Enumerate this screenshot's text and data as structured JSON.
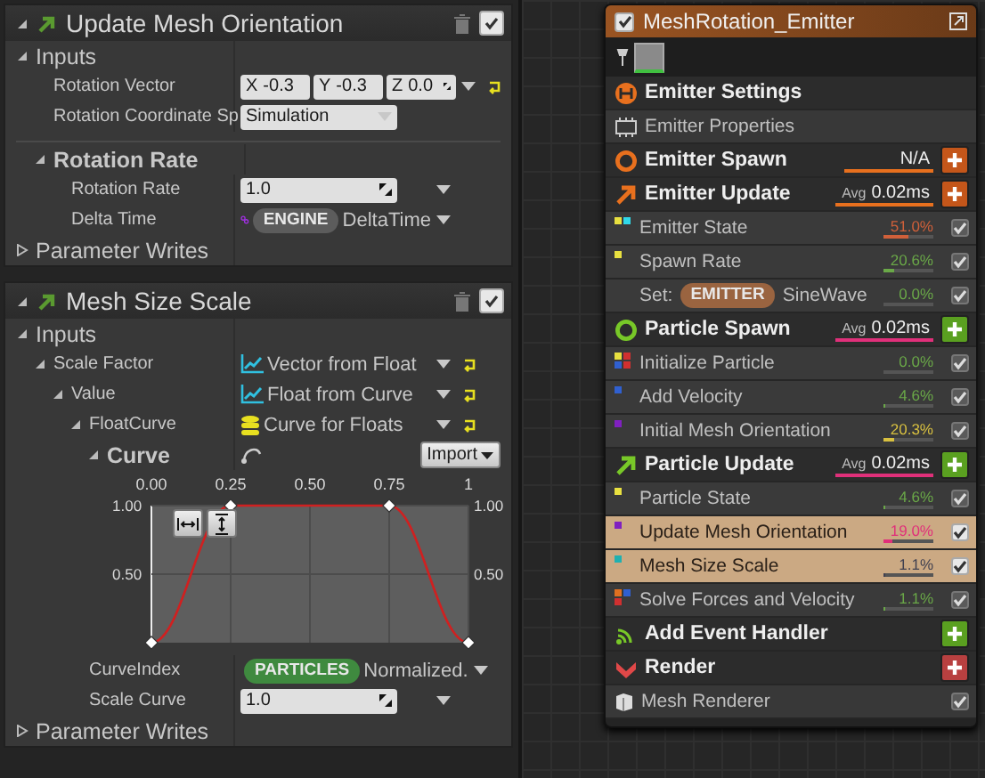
{
  "left_panel": {
    "modules": [
      {
        "title": "Update Mesh Orientation",
        "enabled": true,
        "rows": [
          {
            "kind": "category",
            "label": "Inputs",
            "expanded": true,
            "children": [
              {
                "kind": "vector",
                "label": "Rotation Vector",
                "components": [
                  {
                    "axis": "X",
                    "value": "-0.3"
                  },
                  {
                    "axis": "Y",
                    "value": "-0.3"
                  },
                  {
                    "axis": "Z",
                    "value": "0.0"
                  }
                ],
                "menu": true,
                "reset": true
              },
              {
                "kind": "dropdown",
                "label": "Rotation Coordinate Sp",
                "value": "Simulation",
                "menu": false,
                "reset": false
              },
              {
                "kind": "category",
                "label": "Rotation Rate",
                "expanded": true,
                "children": [
                  {
                    "kind": "number",
                    "label": "Rotation Rate",
                    "value": "1.0",
                    "menu": true,
                    "reset": false
                  },
                  {
                    "kind": "link",
                    "label": "Delta Time",
                    "namespace": {
                      "label": "ENGINE",
                      "color": "#5c5c5c"
                    },
                    "value": "DeltaTime",
                    "menu": true,
                    "reset": false
                  }
                ]
              }
            ]
          },
          {
            "kind": "category",
            "label": "Parameter Writes",
            "expanded": false
          }
        ]
      },
      {
        "title": "Mesh Size Scale",
        "enabled": true,
        "rows": [
          {
            "kind": "category",
            "label": "Inputs",
            "expanded": true,
            "children": [
              {
                "kind": "function",
                "label": "Scale Factor",
                "value": "Vector from Float",
                "expanded": true,
                "menu": true,
                "reset": true,
                "children": [
                  {
                    "kind": "function",
                    "label": "Value",
                    "value": "Float from Curve",
                    "expanded": true,
                    "menu": true,
                    "reset": true,
                    "children": [
                      {
                        "kind": "asset",
                        "label": "FloatCurve",
                        "value": "Curve for Floats",
                        "expanded": true,
                        "menu": true,
                        "reset": true,
                        "children": [
                          {
                            "kind": "curve",
                            "label": "Curve",
                            "expanded": true,
                            "import_button": "Import",
                            "chart_data": {
                              "type": "line",
                              "x": [
                                0,
                                0.25,
                                0.75,
                                1
                              ],
                              "grid": true,
                              "series": [
                                {
                                  "color": "#d02020",
                                  "marker": "diamond",
                                  "values": [
                                    0,
                                    1,
                                    1,
                                    0
                                  ]
                                }
                              ],
                              "xlim": [
                                0,
                                1
                              ],
                              "ylim": [
                                0,
                                1
                              ],
                              "xticks": [
                                {
                                  "value": 0,
                                  "label": "0.00"
                                },
                                {
                                  "value": 0.25,
                                  "label": "0.25"
                                },
                                {
                                  "value": 0.5,
                                  "label": "0.50"
                                },
                                {
                                  "value": 0.75,
                                  "label": "0.75"
                                },
                                {
                                  "value": 1,
                                  "label": "1"
                                }
                              ],
                              "yticks": [
                                {
                                  "value": 0.5,
                                  "label": "0.50"
                                },
                                {
                                  "value": 1,
                                  "label": "1.00"
                                }
                              ]
                            }
                          }
                        ]
                      },
                      {
                        "kind": "link",
                        "label": "CurveIndex",
                        "namespace": {
                          "label": "PARTICLES",
                          "color": "#3f8a3f"
                        },
                        "value": "Normalized.",
                        "menu": true,
                        "reset": false
                      },
                      {
                        "kind": "number",
                        "label": "Scale Curve",
                        "value": "1.0",
                        "menu": true,
                        "reset": false
                      }
                    ]
                  }
                ]
              }
            ]
          },
          {
            "kind": "category",
            "label": "Parameter Writes",
            "expanded": false
          }
        ]
      }
    ]
  },
  "emitter_node": {
    "title": "MeshRotation_Emitter",
    "enabled": true,
    "items": [
      {
        "kind": "section",
        "label": "Emitter Settings",
        "color": "#e8701e"
      },
      {
        "kind": "property",
        "label": "Emitter Properties"
      },
      {
        "kind": "section",
        "label": "Emitter Spawn",
        "color": "#e8701e",
        "stat": {
          "value": "N/A",
          "color": "#e8701e"
        },
        "add_button": {
          "color": "#c4561a"
        }
      },
      {
        "kind": "section",
        "label": "Emitter Update",
        "color": "#e8701e",
        "stat": {
          "prefix": "Avg",
          "value": "0.02ms",
          "color": "#e8701e"
        },
        "add_button": {
          "color": "#c4561a"
        }
      },
      {
        "kind": "module",
        "label": "Emitter State",
        "percent": "51.0%",
        "level": 0.51,
        "color": "#d0603a",
        "checked": true,
        "selected": false,
        "dots": [
          {
            "color": "#e8e040"
          },
          {
            "color": "#30d8e8"
          }
        ]
      },
      {
        "kind": "module",
        "label": "Spawn Rate",
        "percent": "20.6%",
        "level": 0.206,
        "color": "#6aa848",
        "checked": true,
        "selected": false,
        "dots": [
          {
            "color": "#e8e040"
          }
        ]
      },
      {
        "kind": "module",
        "prefix": "Set:",
        "namespace": {
          "label": "EMITTER",
          "color": "#9a6440"
        },
        "label": "SineWave",
        "percent": "0.0%",
        "level": 0,
        "color": "#6aa848",
        "checked": true,
        "selected": false
      },
      {
        "kind": "section",
        "label": "Particle Spawn",
        "color": "#78c828",
        "stat": {
          "prefix": "Avg",
          "value": "0.02ms",
          "color": "#e0307a"
        },
        "add_button": {
          "color": "#5aa020"
        }
      },
      {
        "kind": "module",
        "label": "Initialize Particle",
        "percent": "0.0%",
        "level": 0,
        "color": "#6aa848",
        "checked": true,
        "selected": false,
        "dots": [
          {
            "color": "#e8e040"
          },
          {
            "color": "#d03030"
          },
          {
            "color": "#3060d0"
          },
          {
            "color": "#d03030"
          }
        ]
      },
      {
        "kind": "module",
        "label": "Add Velocity",
        "percent": "4.6%",
        "level": 0.046,
        "color": "#6aa848",
        "checked": true,
        "selected": false,
        "dots": [
          {
            "color": "#3060d0"
          }
        ]
      },
      {
        "kind": "module",
        "label": "Initial Mesh Orientation",
        "percent": "20.3%",
        "level": 0.203,
        "color": "#d8c040",
        "checked": true,
        "selected": false,
        "dots": [
          {
            "color": "#8020c0"
          }
        ]
      },
      {
        "kind": "section",
        "label": "Particle Update",
        "color": "#78c828",
        "stat": {
          "prefix": "Avg",
          "value": "0.02ms",
          "color": "#e0307a"
        },
        "add_button": {
          "color": "#5aa020"
        }
      },
      {
        "kind": "module",
        "label": "Particle State",
        "percent": "4.6%",
        "level": 0.046,
        "color": "#6aa848",
        "checked": true,
        "selected": false,
        "dots": [
          {
            "color": "#e8e040"
          }
        ]
      },
      {
        "kind": "module",
        "label": "Update Mesh Orientation",
        "percent": "19.0%",
        "level": 0.19,
        "color": "#e0307a",
        "checked": true,
        "selected": true,
        "dots": [
          {
            "color": "#8020c0"
          }
        ]
      },
      {
        "kind": "module",
        "label": "Mesh Size Scale",
        "percent": "1.1%",
        "level": 0.011,
        "color": "#404050",
        "checked": true,
        "selected": true,
        "dots": [
          {
            "color": "#20b0b0"
          }
        ]
      },
      {
        "kind": "module",
        "label": "Solve Forces and Velocity",
        "percent": "1.1%",
        "level": 0.011,
        "color": "#6aa848",
        "checked": true,
        "selected": false,
        "dots": [
          {
            "color": "#e07020"
          },
          {
            "color": "#3060d0"
          },
          {
            "color": "#d03030"
          }
        ]
      },
      {
        "kind": "section",
        "label": "Add Event Handler",
        "color": "#78c828",
        "add_button": {
          "color": "#5aa020"
        }
      },
      {
        "kind": "section",
        "label": "Render",
        "color": "#e04848",
        "add_button": {
          "color": "#b84040"
        }
      },
      {
        "kind": "renderer",
        "label": "Mesh Renderer",
        "checked": true
      }
    ]
  }
}
